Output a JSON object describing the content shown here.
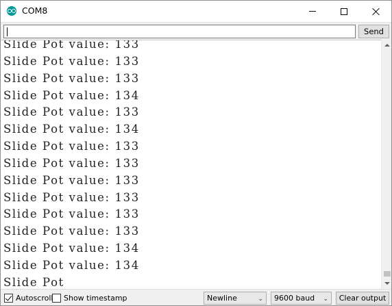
{
  "window": {
    "title": "COM8",
    "icon": "arduino-icon"
  },
  "send_row": {
    "input_value": "",
    "send_label": "Send"
  },
  "output": {
    "lines": [
      "Slide Pot value: 133",
      "Slide Pot value: 133",
      "Slide Pot value: 133",
      "Slide Pot value: 134",
      "Slide Pot value: 133",
      "Slide Pot value: 134",
      "Slide Pot value: 133",
      "Slide Pot value: 133",
      "Slide Pot value: 133",
      "Slide Pot value: 133",
      "Slide Pot value: 133",
      "Slide Pot value: 133",
      "Slide Pot value: 134",
      "Slide Pot value: 134",
      "Slide Pot"
    ]
  },
  "footer": {
    "autoscroll_label": "Autoscroll",
    "autoscroll_checked": true,
    "timestamp_label": "Show timestamp",
    "timestamp_checked": false,
    "line_ending": "Newline",
    "baud_rate": "9600 baud",
    "clear_label": "Clear output"
  },
  "colors": {
    "accent": "#00979c",
    "chrome": "#f0f0f0"
  }
}
